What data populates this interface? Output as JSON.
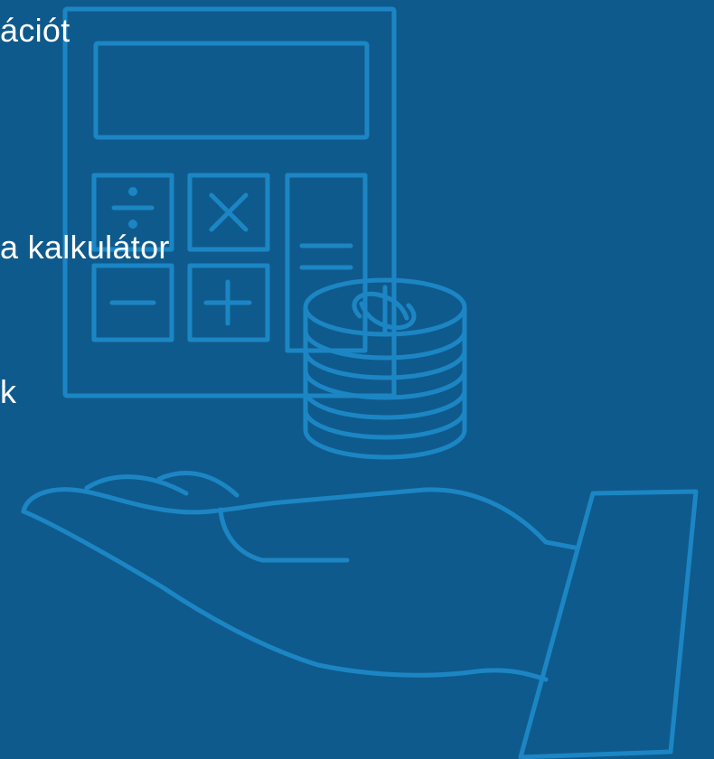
{
  "colors": {
    "background": "#0F5A8C",
    "illustration_line": "#1C86C4",
    "text": "#FFFFFF"
  },
  "illustration": {
    "icons": [
      "calculator-icon",
      "coin-stack-icon",
      "dollar-icon",
      "open-hand-icon"
    ]
  },
  "menu": {
    "items": [
      {
        "label": "ációt"
      },
      {
        "label": "a kalkulátor"
      },
      {
        "label": "k"
      }
    ]
  }
}
